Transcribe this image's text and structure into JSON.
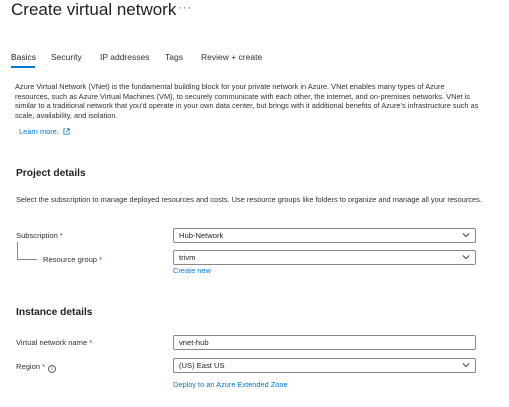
{
  "page": {
    "title": "Create virtual network",
    "more_label": "···"
  },
  "tabs": [
    {
      "label": "Basics"
    },
    {
      "label": "Security"
    },
    {
      "label": "IP addresses"
    },
    {
      "label": "Tags"
    },
    {
      "label": "Review + create"
    }
  ],
  "intro": {
    "text": "Azure Virtual Network (VNet) is the fundamental building block for your private network in Azure. VNet enables many types of Azure resources, such as Azure Virtual Machines (VM), to securely communicate with each other, the internet, and on-premises networks. VNet is similar to a traditional network that you'd operate in your own data center, but brings with it additional benefits of Azure's infrastructure such as scale, availability, and isolation.",
    "learn_more": "Learn more."
  },
  "project_details": {
    "title": "Project details",
    "description": "Select the subscription to manage deployed resources and costs. Use resource groups like folders to organize and manage all your resources.",
    "subscription_label": "Subscription",
    "subscription_value": "Hub-Network",
    "resource_group_label": "Resource group",
    "resource_group_value": "trivm",
    "create_new": "Create new"
  },
  "instance_details": {
    "title": "Instance details",
    "vnet_name_label": "Virtual network name",
    "vnet_name_value": "vnet-hub",
    "region_label": "Region",
    "region_value": "(US) East US",
    "extended_zone_link": "Deploy to an Azure Extended Zone"
  },
  "required_marker": "*",
  "colors": {
    "accent": "#0078d4",
    "required": "#a4262c",
    "border": "#8a8886"
  }
}
